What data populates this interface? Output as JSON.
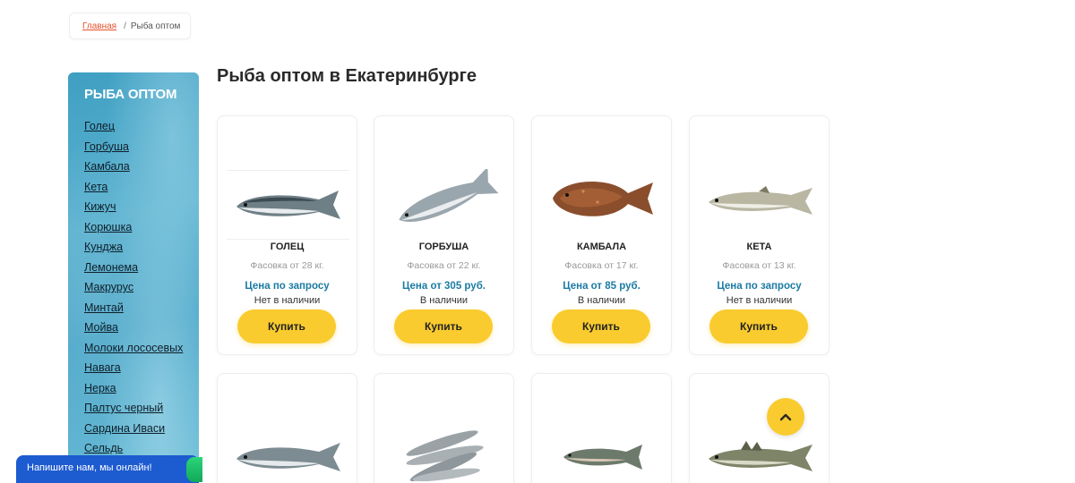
{
  "breadcrumb": {
    "home": "Главная",
    "separator": "/",
    "current": "Рыба оптом"
  },
  "sidebar": {
    "title": "РЫБА ОПТОМ",
    "items": [
      "Голец",
      "Горбуша",
      "Камбала",
      "Кета",
      "Кижуч",
      "Корюшка",
      "Кунджа",
      "Лемонема",
      "Макрурус",
      "Минтай",
      "Мойва",
      "Молоки лососевых",
      "Навага",
      "Нерка",
      "Палтус черный",
      "Сардина Иваси",
      "Сельдь"
    ]
  },
  "page_title": "Рыба оптом в Екатеринбурге",
  "products": [
    {
      "name": "ГОЛЕЦ",
      "pack": "Фасовка от 28 кг.",
      "price": "Цена по запросу",
      "stock": "Нет в наличии",
      "buy": "Купить",
      "image_icon": "char-fish-icon"
    },
    {
      "name": "ГОРБУША",
      "pack": "Фасовка от 22 кг.",
      "price": "Цена от 305 руб.",
      "stock": "В наличии",
      "buy": "Купить",
      "image_icon": "pink-salmon-fish-icon"
    },
    {
      "name": "КАМБАЛА",
      "pack": "Фасовка от 17 кг.",
      "price": "Цена от 85 руб.",
      "stock": "В наличии",
      "buy": "Купить",
      "image_icon": "flounder-fish-icon"
    },
    {
      "name": "КЕТА",
      "pack": "Фасовка от 13 кг.",
      "price": "Цена по запросу",
      "stock": "Нет в наличии",
      "buy": "Купить",
      "image_icon": "chum-salmon-fish-icon"
    }
  ],
  "products_row2_icons": [
    "coho-salmon-fish-icon",
    "smelt-fish-icon",
    "trout-fish-icon",
    "pike-perch-fish-icon"
  ],
  "chat": {
    "label": "Напишите нам, мы онлайн!"
  },
  "colors": {
    "accent": "#f9cb2e",
    "price": "#1b7aa3",
    "link": "#e8502d",
    "chat": "#1d5bd0",
    "sidebar": "#4aa6c8"
  }
}
